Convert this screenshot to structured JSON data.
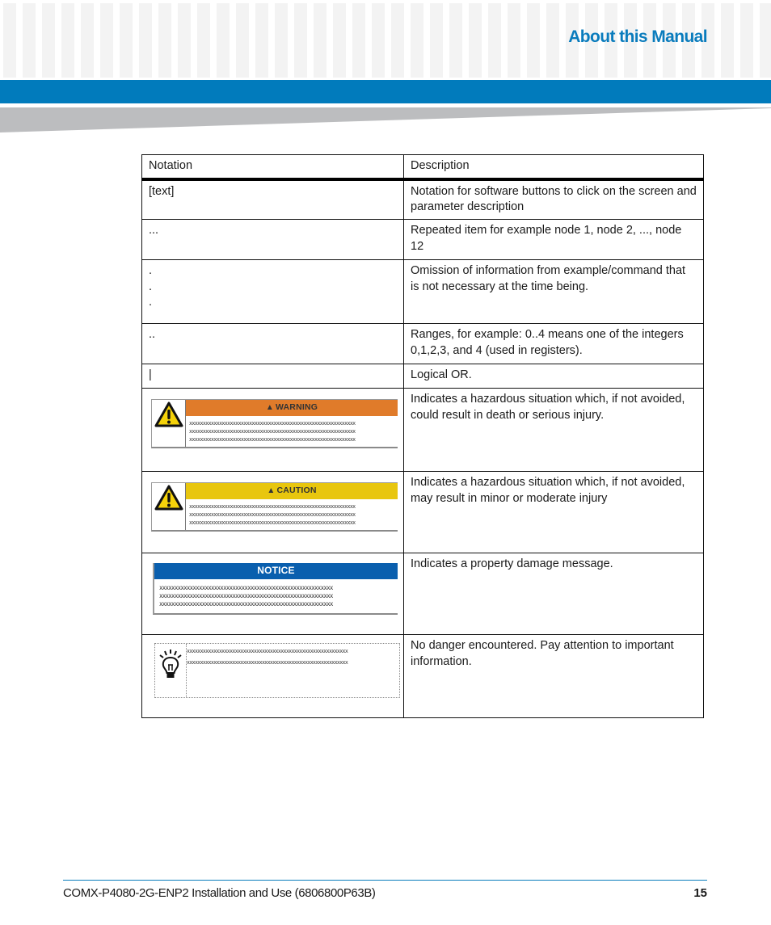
{
  "header": {
    "title": "About this Manual",
    "accent_color": "#017bbc",
    "title_color": "#0a7cbd"
  },
  "table": {
    "columns": [
      "Notation",
      "Description"
    ],
    "rows": [
      {
        "notation": "[text]",
        "description": "Notation for software buttons to click on the screen and parameter description"
      },
      {
        "notation": "...",
        "description": "Repeated item for example node 1, node 2, ..., node 12"
      },
      {
        "notation_lines": [
          ".",
          ".",
          "."
        ],
        "description": "Omission of information from example/command that is not necessary at the time being."
      },
      {
        "notation": "..",
        "description": "Ranges, for example: 0..4 means one of the integers 0,1,2,3, and 4 (used in registers)."
      },
      {
        "notation": "|",
        "description": "Logical OR."
      },
      {
        "notation_graphic": "warning",
        "label": "WARNING",
        "placeholder_text": "xxxxxxxxxxxxxxxxxxxxxxxxxxxxxxxxxxxxxxxxxxxxxxxxxxxxxxxxxxxxx",
        "color": "#e07b2a",
        "description": "Indicates a hazardous situation which, if not avoided, could result in death or serious injury."
      },
      {
        "notation_graphic": "caution",
        "label": "CAUTION",
        "placeholder_text": "xxxxxxxxxxxxxxxxxxxxxxxxxxxxxxxxxxxxxxxxxxxxxxxxxxxxxxxxxxxxx",
        "color": "#e8c60e",
        "description": "Indicates a hazardous situation which, if not avoided, may result in minor or moderate injury"
      },
      {
        "notation_graphic": "notice",
        "label": "NOTICE",
        "placeholder_text": "xxxxxxxxxxxxxxxxxxxxxxxxxxxxxxxxxxxxxxxxxxxxxxxxxxxxxxxxx",
        "color": "#0a5fae",
        "description": "Indicates a property damage message."
      },
      {
        "notation_graphic": "tip",
        "placeholder_text": "xxxxxxxxxxxxxxxxxxxxxxxxxxxxxxxxxxxxxxxxxxxxxxxxxxxxxxxxxxxx",
        "description": "No danger encountered. Pay attention to important information."
      }
    ]
  },
  "footer": {
    "document": "COMX-P4080-2G-ENP2 Installation and Use (6806800P63B)",
    "page_number": "15"
  }
}
